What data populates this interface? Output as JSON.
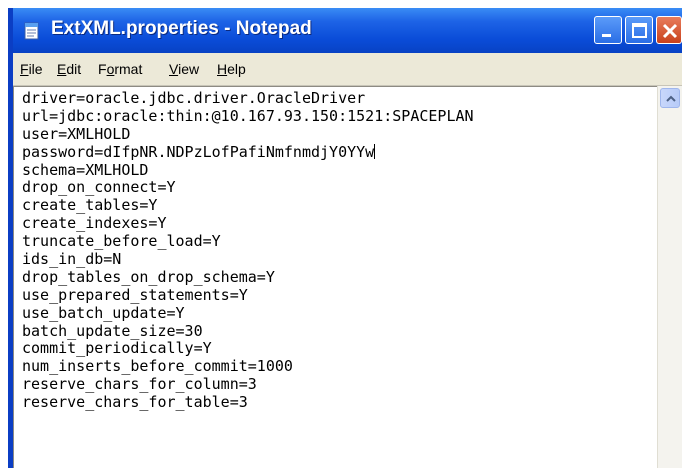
{
  "window": {
    "title": "ExtXML.properties - Notepad",
    "app_icon": "notepad-icon"
  },
  "title_controls": [
    {
      "icon": "minimize-icon"
    },
    {
      "icon": "maximize-icon"
    },
    {
      "icon": "close-icon"
    }
  ],
  "menu": {
    "file": {
      "accel": "F",
      "rest": "ile"
    },
    "edit": {
      "accel": "E",
      "rest": "dit"
    },
    "format": {
      "pre": "F",
      "accel": "o",
      "rest": "rmat"
    },
    "view": {
      "accel": "V",
      "rest": "iew"
    },
    "help": {
      "accel": "H",
      "rest": "elp"
    }
  },
  "editor": {
    "lines": [
      "driver=oracle.jdbc.driver.OracleDriver",
      "url=jdbc:oracle:thin:@10.167.93.150:1521:SPACEPLAN",
      "user=XMLHOLD",
      "password=dIfpNR.NDPzLofPafiNmfnmdjY0YYw",
      "schema=XMLHOLD",
      "drop_on_connect=Y",
      "create_tables=Y",
      "create_indexes=Y",
      "truncate_before_load=Y",
      "ids_in_db=N",
      "drop_tables_on_drop_schema=Y",
      "use_prepared_statements=Y",
      "use_batch_update=Y",
      "batch_update_size=30",
      "commit_periodically=Y",
      "num_inserts_before_commit=1000",
      "reserve_chars_for_column=3",
      "reserve_chars_for_table=3"
    ]
  },
  "scrollbar": {
    "up_icon": "scroll-up-arrow-icon"
  },
  "colors": {
    "titlebar": "#0a4cd8",
    "menubar": "#ece9d8",
    "close_button": "#c9411c"
  }
}
